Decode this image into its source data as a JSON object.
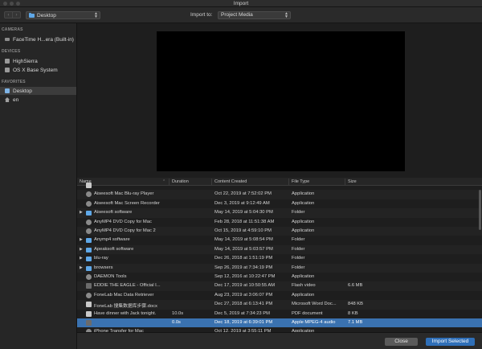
{
  "window": {
    "title": "Import"
  },
  "toolbar": {
    "back_glyph": "‹",
    "forward_glyph": "›",
    "location": "Desktop",
    "import_to_label": "Import to:",
    "import_to_value": "Project Media"
  },
  "sidebar": {
    "cameras_heading": "CAMERAS",
    "cameras": [
      {
        "label": "FaceTime H...era (Built-in)",
        "icon": "camera-icon"
      }
    ],
    "devices_heading": "DEVICES",
    "devices": [
      {
        "label": "HighSierra",
        "icon": "disk-icon"
      },
      {
        "label": "OS X Base System",
        "icon": "disk-icon"
      }
    ],
    "favorites_heading": "FAVORITES",
    "favorites": [
      {
        "label": "Desktop",
        "icon": "desktop-folder-icon",
        "selected": true
      },
      {
        "label": "en",
        "icon": "home-icon",
        "selected": false
      }
    ]
  },
  "table": {
    "columns": {
      "name": "Name",
      "duration": "Duration",
      "created": "Content Created",
      "type": "File Type",
      "size": "Size"
    },
    "rows": [
      {
        "kind": "doc",
        "expand": false,
        "name": "",
        "duration": "",
        "created": "",
        "type": "",
        "size": ""
      },
      {
        "kind": "app",
        "expand": false,
        "name": "Aiseesoft Mac Blu-ray Player",
        "duration": "",
        "created": "Oct 22, 2019 at 7:52:02 PM",
        "type": "Application",
        "size": ""
      },
      {
        "kind": "app",
        "expand": false,
        "name": "Aiseesoft Mac Screen Recorder",
        "duration": "",
        "created": "Dec 3, 2019 at 9:12:49 AM",
        "type": "Application",
        "size": ""
      },
      {
        "kind": "folder",
        "expand": true,
        "name": "Aiseesoft software",
        "duration": "",
        "created": "May 14, 2019 at 5:04:30 PM",
        "type": "Folder",
        "size": ""
      },
      {
        "kind": "app",
        "expand": false,
        "name": "AnyMP4 DVD Copy for Mac",
        "duration": "",
        "created": "Feb 28, 2018 at 11:51:38 AM",
        "type": "Application",
        "size": ""
      },
      {
        "kind": "app",
        "expand": false,
        "name": "AnyMP4 DVD Copy for Mac 2",
        "duration": "",
        "created": "Oct 15, 2019 at 4:59:10 PM",
        "type": "Application",
        "size": ""
      },
      {
        "kind": "folder",
        "expand": true,
        "name": "Anymp4 software",
        "duration": "",
        "created": "May 14, 2019 at 5:08:54 PM",
        "type": "Folder",
        "size": ""
      },
      {
        "kind": "folder",
        "expand": true,
        "name": "Apeaksoft software",
        "duration": "",
        "created": "May 14, 2019 at 5:03:57 PM",
        "type": "Folder",
        "size": ""
      },
      {
        "kind": "folder",
        "expand": true,
        "name": "blu-ray",
        "duration": "",
        "created": "Dec 26, 2018 at 1:51:19 PM",
        "type": "Folder",
        "size": ""
      },
      {
        "kind": "folder",
        "expand": true,
        "name": "browsers",
        "duration": "",
        "created": "Sep 26, 2019 at 7:34:19 PM",
        "type": "Folder",
        "size": ""
      },
      {
        "kind": "app",
        "expand": false,
        "name": "DAEMON Tools",
        "duration": "",
        "created": "Sep 12, 2016 at 10:22:47 PM",
        "type": "Application",
        "size": ""
      },
      {
        "kind": "video",
        "expand": false,
        "name": "EDDIE THE EAGLE - Official I...",
        "duration": "",
        "created": "Dec 17, 2019 at 10:50:55 AM",
        "type": "Flash video",
        "size": "6.6 MB"
      },
      {
        "kind": "app",
        "expand": false,
        "name": "FoneLab Mac Data Retriever",
        "duration": "",
        "created": "Aug 23, 2019 at 3:06:07 PM",
        "type": "Application",
        "size": ""
      },
      {
        "kind": "doc",
        "expand": false,
        "name": "FoneLab 搜集数据库步骤.docx",
        "duration": "",
        "created": "Dec 27, 2018 at 6:13:41 PM",
        "type": "Microsoft Word Doc...",
        "size": "848 KB"
      },
      {
        "kind": "doc",
        "expand": false,
        "name": "Have dinner with Jack tonight.",
        "duration": "10.0s",
        "created": "Dec 5, 2019 at 7:34:23 PM",
        "type": "PDF document",
        "size": "8 KB"
      },
      {
        "kind": "video",
        "expand": false,
        "name": "",
        "duration": "0.0s",
        "created": "Dec 18, 2019 at 6:39:01 PM",
        "type": "Apple MPEG-4 audio",
        "size": "7.1 MB",
        "selected": true
      },
      {
        "kind": "app",
        "expand": false,
        "name": "iPhone Transfer for Mac",
        "duration": "",
        "created": "Oct 12, 2019 at 3:55:11 PM",
        "type": "Application",
        "size": ""
      }
    ]
  },
  "buttons": {
    "close": "Close",
    "import_selected": "Import Selected"
  }
}
